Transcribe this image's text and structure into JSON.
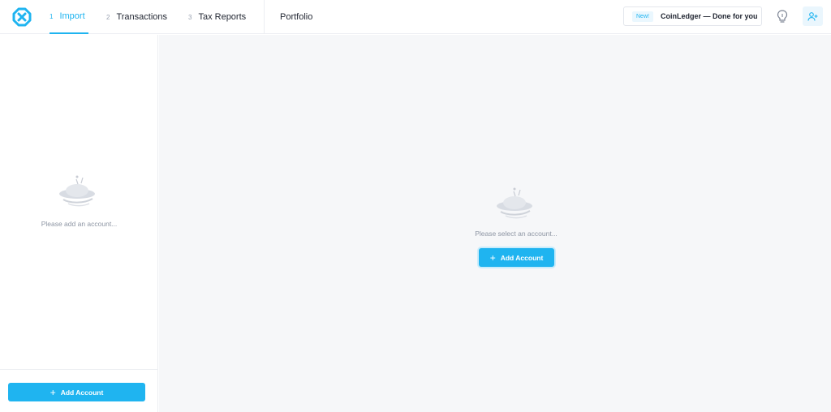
{
  "header": {
    "steps": [
      {
        "num": "1",
        "label": "Import"
      },
      {
        "num": "2",
        "label": "Transactions"
      },
      {
        "num": "3",
        "label": "Tax Reports"
      }
    ],
    "portfolio_label": "Portfolio",
    "promo": {
      "badge": "New!",
      "text": "CoinLedger — Done for you"
    }
  },
  "sidebar": {
    "empty_text": "Please add an account...",
    "add_button_label": "Add Account"
  },
  "main": {
    "empty_text": "Please select an account...",
    "add_button_label": "Add Account"
  },
  "colors": {
    "accent": "#1fb4f0",
    "background": "#f6f7f9"
  },
  "icons": [
    "logo-icon",
    "lightbulb-icon",
    "add-user-icon",
    "plus-icon",
    "empty-state-illustration"
  ]
}
